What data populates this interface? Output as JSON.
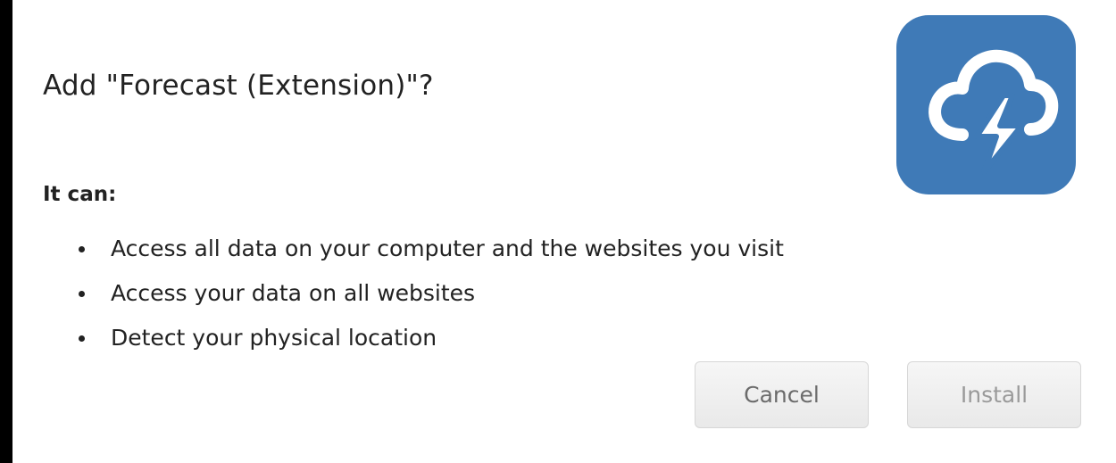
{
  "dialog": {
    "title": "Add \"Forecast (Extension)\"?",
    "permissions_heading": "It can:",
    "permissions": [
      "Access all data on your computer and the websites you visit",
      "Access your data on all websites",
      "Detect your physical location"
    ],
    "buttons": {
      "cancel_label": "Cancel",
      "install_label": "Install"
    },
    "icon": {
      "name": "cloud-lightning-icon",
      "background_color": "#3f7ab7",
      "glyph_color": "#ffffff"
    }
  }
}
